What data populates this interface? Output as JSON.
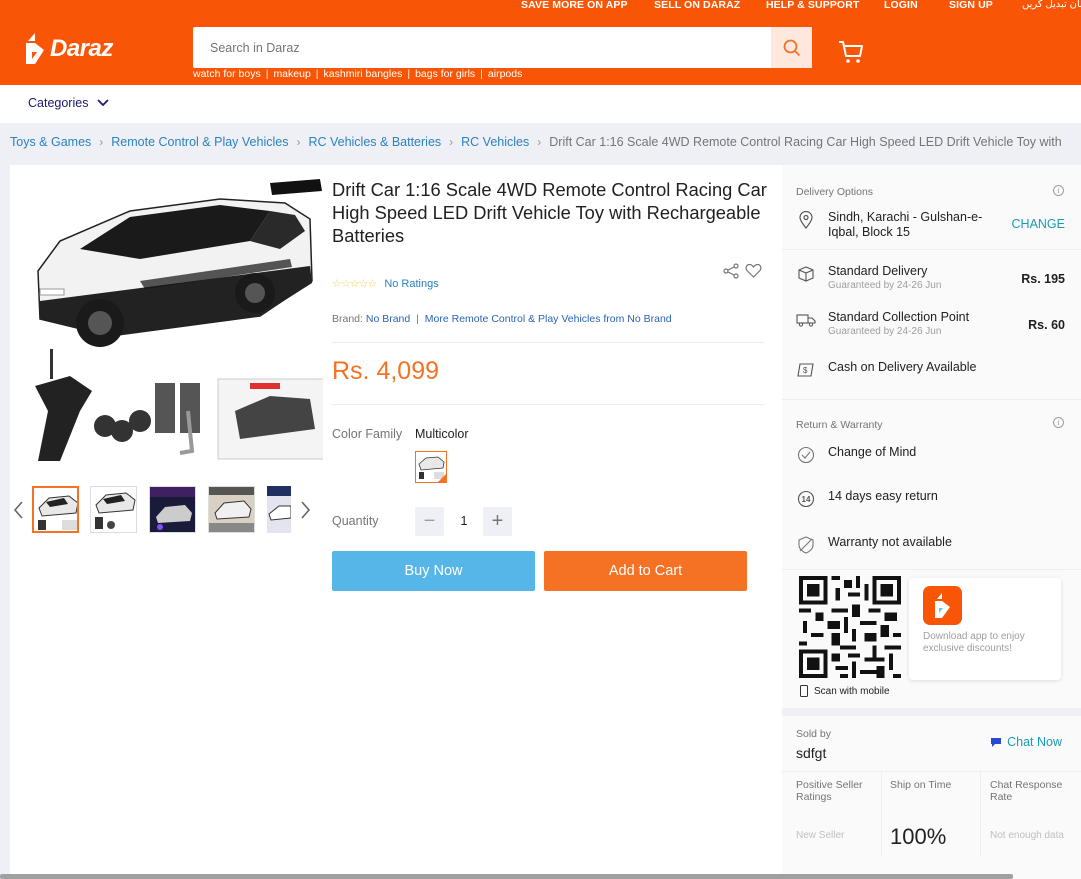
{
  "topnav": {
    "save_more": "SAVE MORE ON APP",
    "sell": "SELL ON DARAZ",
    "help": "HELP & SUPPORT",
    "login": "LOGIN",
    "signup": "SIGN UP",
    "language": "زبان تبدیل کریں"
  },
  "logo": {
    "text": "Daraz"
  },
  "search": {
    "placeholder": "Search in Daraz"
  },
  "suggestions": [
    "watch for boys",
    "makeup",
    "kashmiri bangles",
    "bags for girls",
    "airpods"
  ],
  "categories_label": "Categories",
  "breadcrumb": {
    "items": [
      "Toys & Games",
      "Remote Control & Play Vehicles",
      "RC Vehicles & Batteries",
      "RC Vehicles"
    ],
    "current": "Drift Car 1:16 Scale 4WD Remote Control Racing Car High Speed LED Drift Vehicle Toy with"
  },
  "product": {
    "title": "Drift Car 1:16 Scale 4WD Remote Control Racing Car High Speed LED Drift Vehicle Toy with Rechargeable Batteries",
    "stars": "☆☆☆☆☆",
    "ratings": "No Ratings",
    "brand_label": "Brand:",
    "brand": "No Brand",
    "brand_sep": "|",
    "more_link": "More Remote Control & Play Vehicles from No Brand",
    "price": "Rs. 4,099",
    "color_label": "Color Family",
    "color_value": "Multicolor",
    "quantity_label": "Quantity",
    "quantity": "1",
    "minus": "−",
    "plus": "+",
    "buy_now": "Buy Now",
    "add_to_cart": "Add to Cart"
  },
  "delivery": {
    "heading": "Delivery Options",
    "location": "Sindh, Karachi - Gulshan-e-Iqbal, Block 15",
    "change": "CHANGE",
    "standard": {
      "label": "Standard Delivery",
      "sub": "Guaranteed by 24-26 Jun",
      "price": "Rs. 195"
    },
    "collection": {
      "label": "Standard Collection Point",
      "sub": "Guaranteed by 24-26 Jun",
      "price": "Rs. 60"
    },
    "cod": "Cash on Delivery Available"
  },
  "returns": {
    "heading": "Return & Warranty",
    "change_mind": "Change of Mind",
    "easy_return": "14 days easy return",
    "warranty": "Warranty not available",
    "return_badge": "14"
  },
  "app": {
    "download": "Download app to enjoy exclusive discounts!",
    "scan": "Scan with mobile"
  },
  "seller": {
    "sold_by": "Sold by",
    "name": "sdfgt",
    "chat": "Chat Now",
    "stats": [
      {
        "label": "Positive Seller Ratings",
        "value": "New Seller"
      },
      {
        "label": "Ship on Time",
        "value": "100%"
      },
      {
        "label": "Chat Response Rate",
        "value": "Not enough data"
      }
    ]
  },
  "colors": {
    "brand_orange": "#f85606",
    "price_orange": "#f57224",
    "buy_blue": "#56b6e8",
    "link_blue": "#2a82c1",
    "teal": "#1a9cb7"
  }
}
